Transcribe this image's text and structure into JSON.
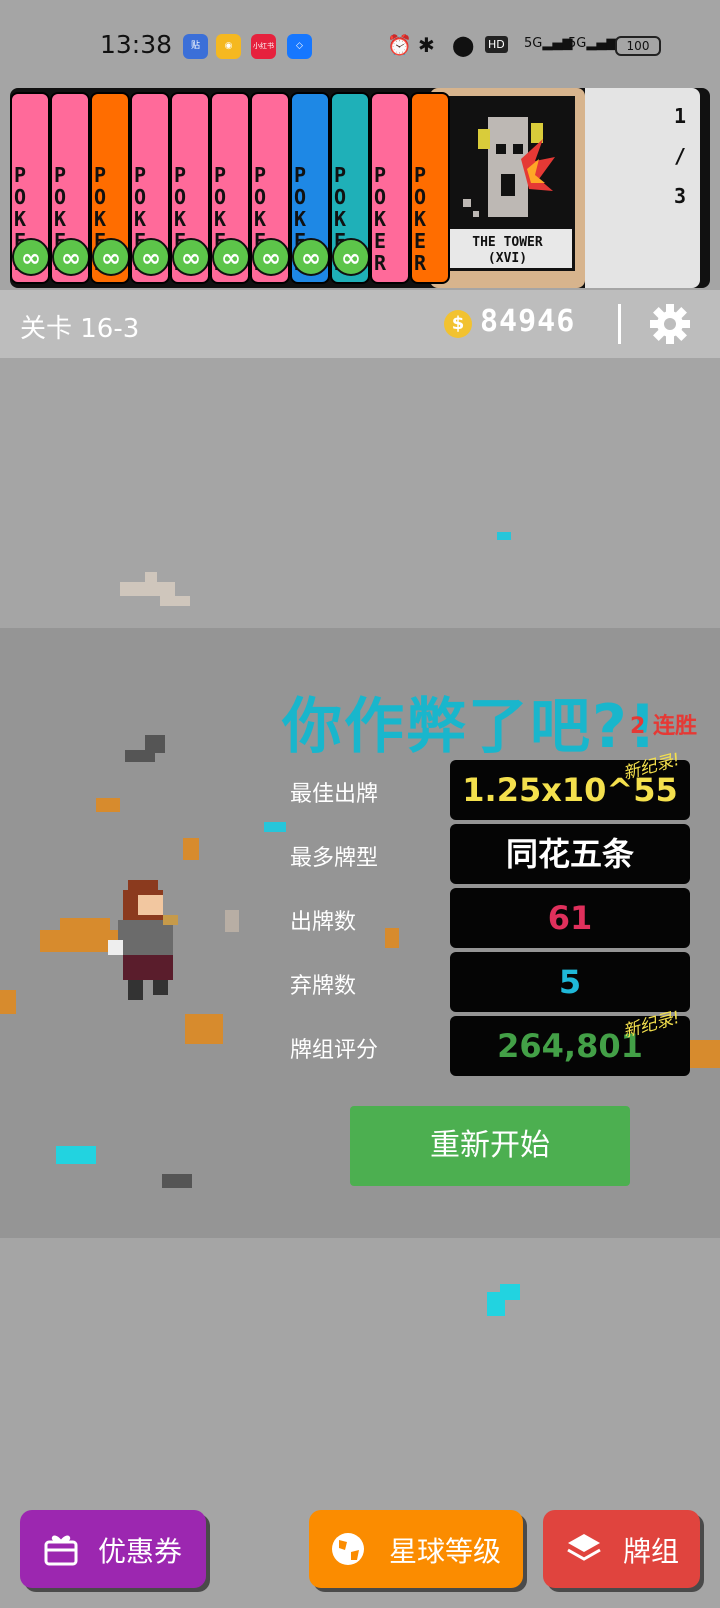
{
  "status_bar": {
    "time": "13:38",
    "apps": [
      {
        "icon": "tieba-icon",
        "text": "贴",
        "color": "#3b6fd8"
      },
      {
        "icon": "weibo-icon",
        "text": "◉",
        "color": "#f5b820"
      },
      {
        "icon": "xiaohongshu-icon",
        "text": "小红书",
        "color": "#e6213d"
      },
      {
        "icon": "alipay-icon",
        "text": "◇",
        "color": "#1677ff"
      }
    ],
    "hd": "HD",
    "network": "5G",
    "battery": "100"
  },
  "cards": {
    "items": [
      {
        "color": "#ff6a9a",
        "text": "POKER",
        "badge": "∞"
      },
      {
        "color": "#ff6a9a",
        "text": "POKER",
        "badge": "∞"
      },
      {
        "color": "#ff6d00",
        "text": "POKER",
        "badge": "∞"
      },
      {
        "color": "#ff6a9a",
        "text": "POKER",
        "badge": "∞"
      },
      {
        "color": "#ff6a9a",
        "text": "POKER",
        "badge": "∞"
      },
      {
        "color": "#ff6a9a",
        "text": "POKER",
        "badge": "∞"
      },
      {
        "color": "#ff6a9a",
        "text": "POKER",
        "badge": "∞"
      },
      {
        "color": "#1e88e5",
        "text": "POKER",
        "badge": "∞"
      },
      {
        "color": "#1fb0b8",
        "text": "POKER",
        "badge": "∞"
      },
      {
        "color": "#ff6a9a",
        "text": "POKER",
        "badge": ""
      },
      {
        "color": "#ff6d00",
        "text": "POKER",
        "badge": ""
      }
    ],
    "tarot_title": "THE TOWER",
    "tarot_numeral": "(XVI)",
    "count_top": "1",
    "count_sep": "/",
    "count_bottom": "3"
  },
  "level_bar": {
    "level": "关卡 16-3",
    "coin_symbol": "$",
    "money": "84946"
  },
  "result": {
    "headline": "你作弊了吧?!",
    "streak": "2 连胜",
    "new_record": "新纪录!",
    "stats": [
      {
        "label": "最佳出牌",
        "value": "1.25x10^55",
        "color": "#f4e04d"
      },
      {
        "label": "最多牌型",
        "value": "同花五条",
        "color": "#ffffff"
      },
      {
        "label": "出牌数",
        "value": "61",
        "color": "#e0305c"
      },
      {
        "label": "弃牌数",
        "value": "5",
        "color": "#1fb8d8"
      },
      {
        "label": "牌组评分",
        "value": "264,801",
        "color": "#43a047"
      }
    ],
    "restart_label": "重新开始"
  },
  "bottom_bar": {
    "coupon_label": "优惠券",
    "planet_label": "星球等级",
    "deck_label": "牌组"
  },
  "colors": {
    "background": "#a5a5a5",
    "band": "#959595",
    "headline": "#19b6cc",
    "coupon": "#9c27b0",
    "planet": "#fb8c00",
    "deck": "#e0443e",
    "restart": "#4caf50"
  }
}
